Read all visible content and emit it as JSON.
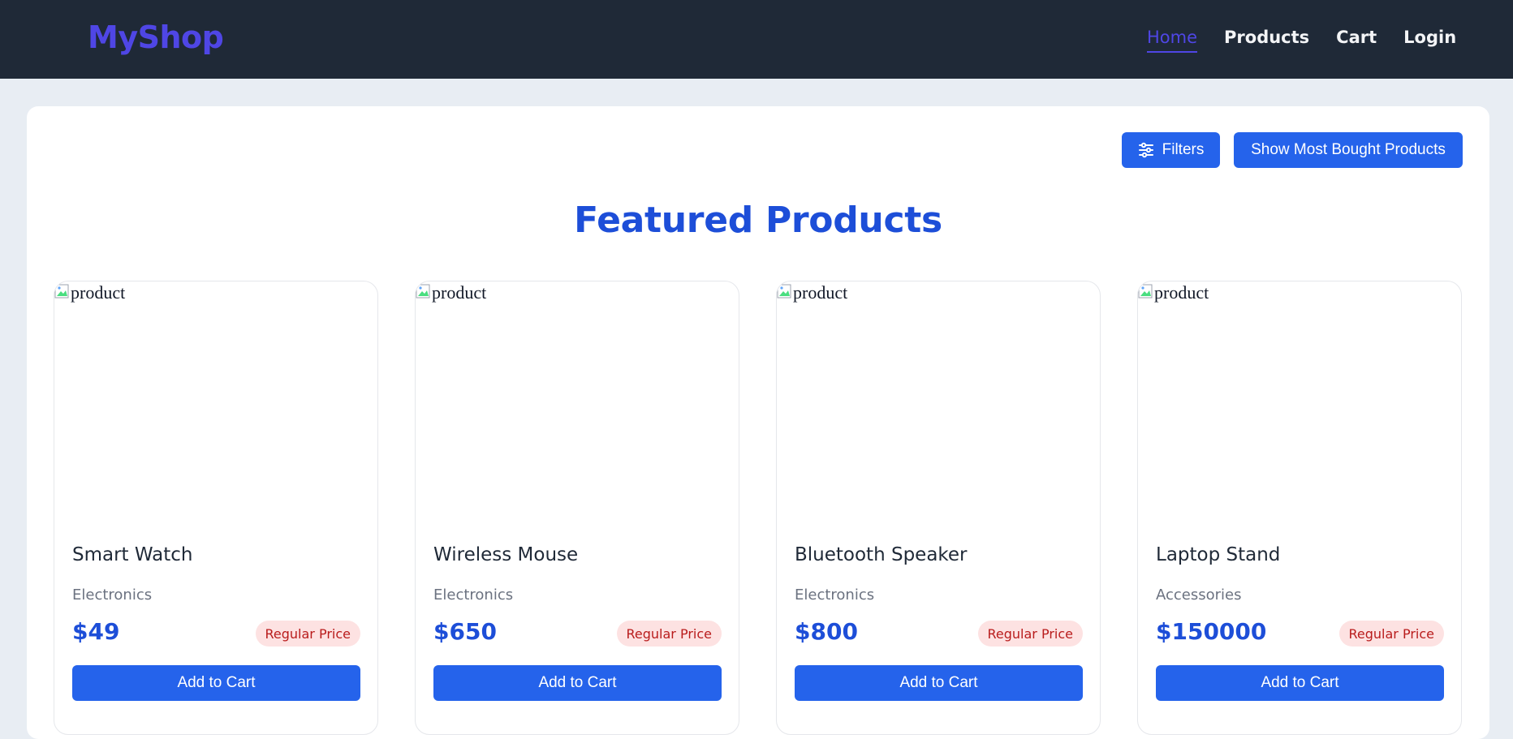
{
  "header": {
    "brand": "MyShop",
    "nav": [
      {
        "label": "Home",
        "active": true
      },
      {
        "label": "Products",
        "active": false
      },
      {
        "label": "Cart",
        "active": false
      },
      {
        "label": "Login",
        "active": false
      }
    ]
  },
  "toolbar": {
    "filters_label": "Filters",
    "filters_icon": "sliders-icon",
    "most_bought_label": "Show Most Bought Products"
  },
  "main": {
    "title": "Featured Products",
    "products": [
      {
        "image_alt": "product",
        "name": "Smart Watch",
        "category": "Electronics",
        "price": "$49",
        "badge": "Regular Price",
        "button": "Add to Cart"
      },
      {
        "image_alt": "product",
        "name": "Wireless Mouse",
        "category": "Electronics",
        "price": "$650",
        "badge": "Regular Price",
        "button": "Add to Cart"
      },
      {
        "image_alt": "product",
        "name": "Bluetooth Speaker",
        "category": "Electronics",
        "price": "$800",
        "badge": "Regular Price",
        "button": "Add to Cart"
      },
      {
        "image_alt": "product",
        "name": "Laptop Stand",
        "category": "Accessories",
        "price": "$150000",
        "badge": "Regular Price",
        "button": "Add to Cart"
      }
    ]
  },
  "colors": {
    "navbar_bg": "#1f2937",
    "brand": "#4f46e5",
    "accent": "#2563eb",
    "title": "#1d4ed8",
    "badge_bg": "#fde2e2",
    "badge_text": "#b91c1c",
    "page_bg": "#e8edf3"
  }
}
